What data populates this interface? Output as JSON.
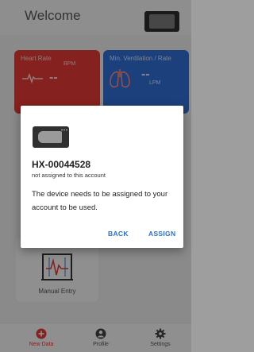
{
  "header": {
    "title": "Welcome"
  },
  "tiles": {
    "heart_rate": {
      "label": "Heart Rate",
      "unit": "BPM",
      "value": "--",
      "icon": "heartbeat-line-icon"
    },
    "ventilation": {
      "label": "Min. Ventilation / Rate",
      "unit": "LPM",
      "value": "--",
      "icon": "lungs-icon"
    },
    "manual_entry": {
      "label": "Manual Entry",
      "icon": "manual-entry-icon"
    }
  },
  "dialog": {
    "device_id": "HX-00044528",
    "status": "not assigned to this account",
    "message": "The device needs to be assigned to your account to be used.",
    "back_label": "BACK",
    "assign_label": "ASSIGN"
  },
  "bottom_nav": {
    "items": [
      {
        "label": "New Data",
        "icon": "plus-circle-icon",
        "active": true
      },
      {
        "label": "Profile",
        "icon": "person-icon",
        "active": false
      },
      {
        "label": "Settings",
        "icon": "gear-icon",
        "active": false
      }
    ]
  },
  "colors": {
    "accent_red": "#e53935",
    "accent_blue": "#2f6fd6",
    "button_blue": "#2a6fd0"
  }
}
